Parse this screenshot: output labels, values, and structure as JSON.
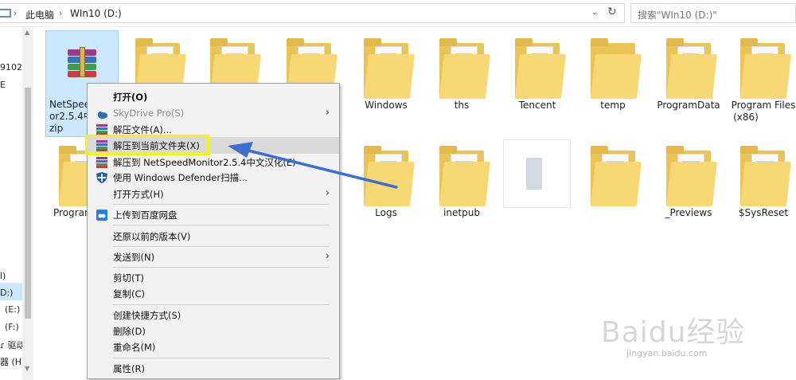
{
  "address": {
    "crumb1": "此电脑",
    "crumb2": "WIn10 (D:)",
    "dropdown": "⌄",
    "refresh": "↻"
  },
  "search": {
    "placeholder": "搜索\"WIn10 (D:)\""
  },
  "nav": {
    "items": [
      "9102",
      "E",
      "l)",
      "D:)",
      "(E:)",
      "(F:)",
      "ɾ 驱动",
      "器 (H:"
    ]
  },
  "files": [
    {
      "label_l1": "NetSpeed",
      "label_l2": "or2.5.4中文",
      "label_l3": "zip"
    },
    {
      "label": "Windows"
    },
    {
      "label": "ths"
    },
    {
      "label": "Tencent"
    },
    {
      "label": "temp"
    },
    {
      "label": "ProgramData"
    },
    {
      "label_l1": "Program Files",
      "label_l2": "(x86)"
    },
    {
      "label": "Program"
    },
    {
      "label": "Logs"
    },
    {
      "label": "inetpub"
    },
    {
      "label": "_Previews"
    },
    {
      "label": "$SysReset"
    }
  ],
  "menu": {
    "items": [
      {
        "label": "打开(O)"
      },
      {
        "label": "SkyDrive Pro(S)"
      },
      {
        "label": "解压文件(A)..."
      },
      {
        "label": "解压到当前文件夹(X)"
      },
      {
        "label": "解压到 NetSpeedMonitor2.5.4中文汉化(E)"
      },
      {
        "label": "使用 Windows Defender扫描..."
      },
      {
        "label": "打开方式(H)"
      },
      {
        "label": "上传到百度网盘"
      },
      {
        "label": "还原以前的版本(V)"
      },
      {
        "label": "发送到(N)"
      },
      {
        "label": "剪切(T)"
      },
      {
        "label": "复制(C)"
      },
      {
        "label": "创建快捷方式(S)"
      },
      {
        "label": "删除(D)"
      },
      {
        "label": "重命名(M)"
      },
      {
        "label": "属性(R)"
      }
    ],
    "submenu_arrow": "›"
  },
  "colors": {
    "highlight_box": "#f5f512",
    "arrow": "#3d6fd1",
    "selection": "#cce8ff",
    "folder": "#f8d775"
  },
  "watermark": {
    "text": "Baidu经验",
    "sub": "jingyan.baidu.com"
  }
}
